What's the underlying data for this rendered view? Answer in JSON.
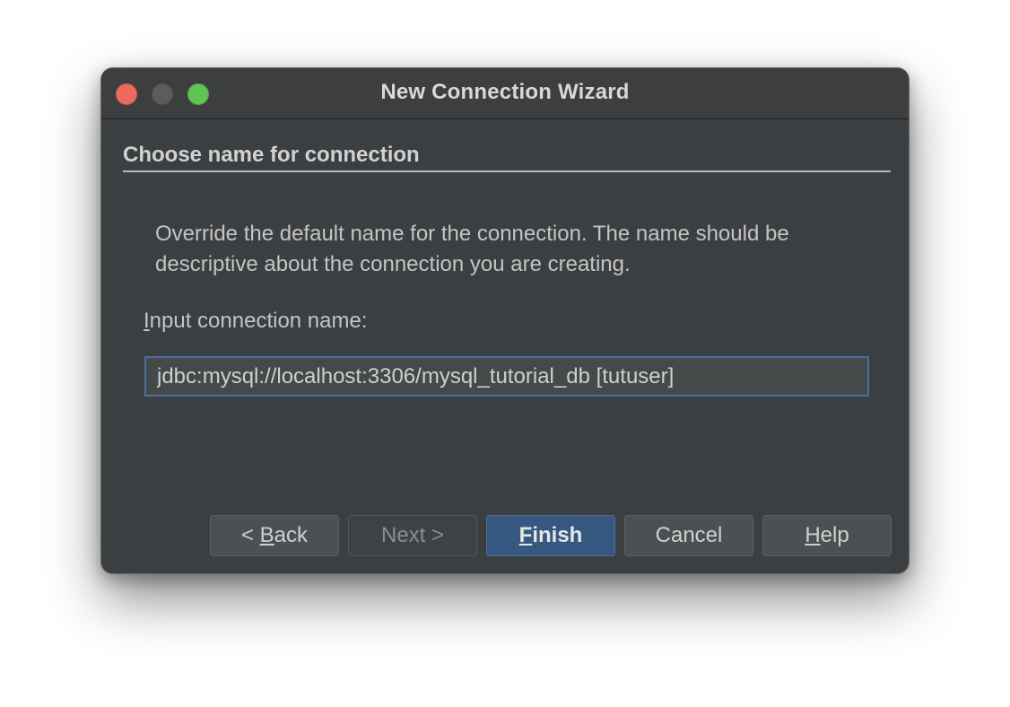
{
  "window": {
    "title": "New Connection Wizard"
  },
  "colors": {
    "close": "#ec6a5e",
    "minimize": "#5b5c5e",
    "zoom": "#61c454",
    "window_bg": "#3c3f41",
    "primary_button": "#365880",
    "focus_border": "#4a6f9c"
  },
  "section": {
    "heading": "Choose name for connection"
  },
  "description": "Override the default name for the connection. The name should be descriptive about the connection you are creating.",
  "input": {
    "label_mnemonic": "I",
    "label_rest": "nput connection name:",
    "value": "jdbc:mysql://localhost:3306/mysql_tutorial_db [tutuser]"
  },
  "buttons": {
    "back": {
      "prefix": "< ",
      "mnemonic": "B",
      "rest": "ack"
    },
    "next": {
      "label": "Next >"
    },
    "finish": {
      "mnemonic": "F",
      "rest": "inish"
    },
    "cancel": {
      "label": "Cancel"
    },
    "help": {
      "mnemonic": "H",
      "rest": "elp"
    }
  }
}
